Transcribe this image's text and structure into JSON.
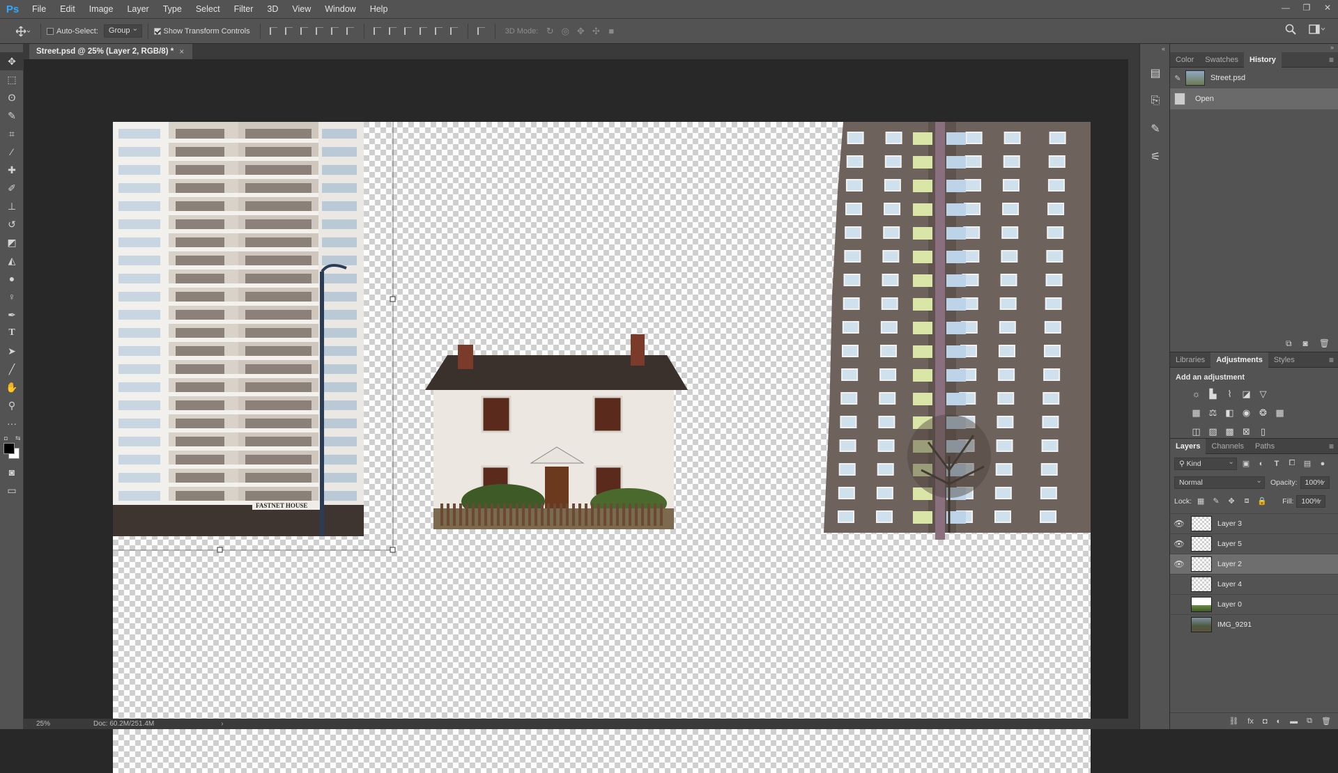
{
  "app": {
    "logo": "Ps"
  },
  "menu": [
    "File",
    "Edit",
    "Image",
    "Layer",
    "Type",
    "Select",
    "Filter",
    "3D",
    "View",
    "Window",
    "Help"
  ],
  "window_controls": {
    "minimize": "—",
    "restore": "❐",
    "close": "✕"
  },
  "options": {
    "auto_select_label": "Auto-Select:",
    "auto_select_checked": false,
    "group_value": "Group",
    "transform_label": "Show Transform Controls",
    "transform_checked": true,
    "mode_3d_label": "3D Mode:"
  },
  "document": {
    "tab_title": "Street.psd @ 25% (Layer 2, RGB/8) *",
    "close": "×"
  },
  "canvas_art": {
    "building_sign": "FASTNET HOUSE"
  },
  "status": {
    "zoom": "25%",
    "doc": "Doc: 60.2M/251.4M",
    "arrow": "›"
  },
  "history_panel": {
    "tabs": [
      "Color",
      "Swatches",
      "History"
    ],
    "active_tab": "History",
    "snapshot": "Street.psd",
    "states": [
      {
        "label": "Open",
        "selected": true
      }
    ]
  },
  "adjustments_panel": {
    "tabs": [
      "Libraries",
      "Adjustments",
      "Styles"
    ],
    "active_tab": "Adjustments",
    "title": "Add an adjustment"
  },
  "layers_panel": {
    "tabs": [
      "Layers",
      "Channels",
      "Paths"
    ],
    "active_tab": "Layers",
    "filter_kind": "Kind",
    "blend_mode": "Normal",
    "opacity_label": "Opacity:",
    "opacity": "100%",
    "lock_label": "Lock:",
    "fill_label": "Fill:",
    "fill": "100%",
    "layers": [
      {
        "name": "Layer 3",
        "visible": true,
        "selected": false,
        "thumb": "transparent"
      },
      {
        "name": "Layer 5",
        "visible": true,
        "selected": false,
        "thumb": "transparent"
      },
      {
        "name": "Layer 2",
        "visible": true,
        "selected": true,
        "thumb": "transparent"
      },
      {
        "name": "Layer 4",
        "visible": false,
        "selected": false,
        "thumb": "transparent"
      },
      {
        "name": "Layer 0",
        "visible": false,
        "selected": false,
        "thumb": "green"
      },
      {
        "name": "IMG_9291",
        "visible": false,
        "selected": false,
        "thumb": "photo"
      }
    ]
  },
  "colors": {
    "accent": "#31a8ff",
    "panel": "#535353",
    "workspace": "#282828"
  }
}
